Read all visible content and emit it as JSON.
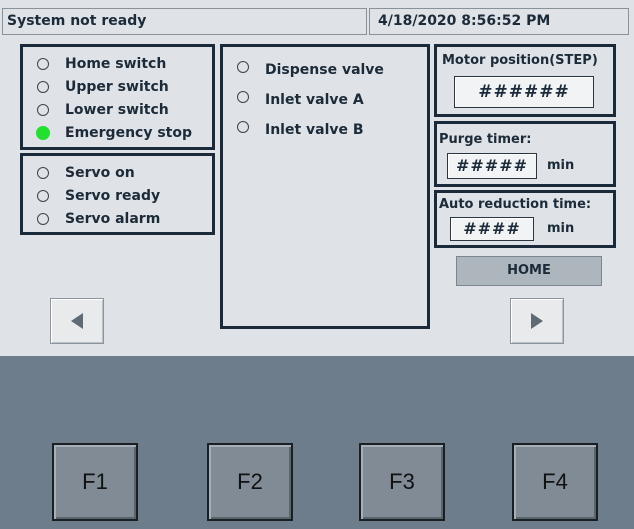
{
  "header": {
    "status": "System not ready",
    "datetime": "4/18/2020 8:56:52 PM"
  },
  "switches": [
    {
      "label": "Home switch",
      "on": false
    },
    {
      "label": "Upper switch",
      "on": false
    },
    {
      "label": "Lower switch",
      "on": false
    },
    {
      "label": "Emergency stop",
      "on": true
    }
  ],
  "servo": [
    {
      "label": "Servo on",
      "on": false
    },
    {
      "label": "Servo ready",
      "on": false
    },
    {
      "label": "Servo alarm",
      "on": false
    }
  ],
  "valves": [
    {
      "label": "Dispense valve",
      "on": false
    },
    {
      "label": "Inlet valve A",
      "on": false
    },
    {
      "label": "Inlet valve B",
      "on": false
    }
  ],
  "motor": {
    "label": "Motor position(STEP)",
    "value": "######"
  },
  "purge": {
    "label": "Purge timer:",
    "value": "#####",
    "unit": "min"
  },
  "auto_reduction": {
    "label": "Auto reduction time:",
    "value": "####",
    "unit": "min"
  },
  "home_button": "HOME",
  "function_keys": [
    "F1",
    "F2",
    "F3",
    "F4"
  ],
  "colors": {
    "led_on": "#22e02c",
    "panel_border": "#1b2a3a",
    "background": "#6e7d8c",
    "screen": "#dfe2e6"
  },
  "icons": {
    "prev": "left-arrow-icon",
    "next": "right-arrow-icon"
  }
}
